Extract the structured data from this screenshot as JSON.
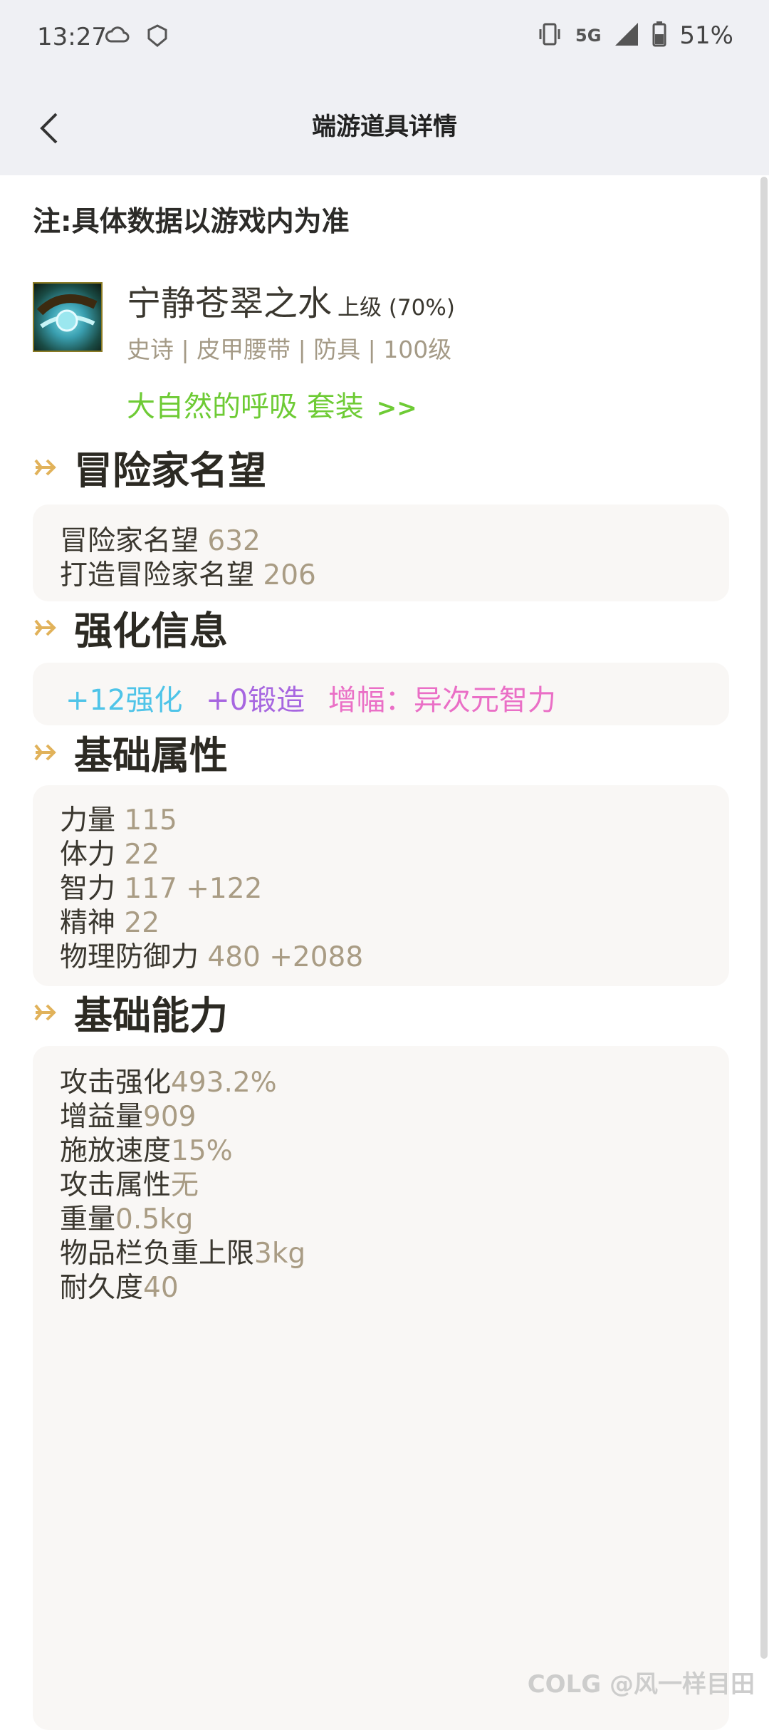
{
  "status_bar": {
    "time": "13:27",
    "network": "5G",
    "battery": "51%"
  },
  "header": {
    "title": "端游道具详情"
  },
  "note": "注:具体数据以游戏内为准",
  "item": {
    "name": "宁静苍翠之水",
    "grade": "上级 (70%)",
    "tags": "史诗  | 皮甲腰带  | 防具  | 100级",
    "set_name": "大自然的呼吸 套装",
    "set_arrows": ">>",
    "set_color": "#6ecb35"
  },
  "sections": {
    "reputation": {
      "title": "冒险家名望",
      "rows": [
        {
          "label": "冒险家名望",
          "value": " 632"
        },
        {
          "label": "打造冒险家名望",
          "value": " 206"
        }
      ]
    },
    "enhance": {
      "title": "强化信息",
      "reinforce": "+12强化",
      "reinforce_color": "#4fc4e8",
      "forge": "+0锻造",
      "forge_color": "#a766e0",
      "amplify": "增幅：异次元智力",
      "amplify_color": "#ea6fc6"
    },
    "base_attr": {
      "title": "基础属性",
      "rows": [
        {
          "label": "力量",
          "value": " 115"
        },
        {
          "label": "体力",
          "value": " 22"
        },
        {
          "label": "智力",
          "value": " 117 +122"
        },
        {
          "label": "精神",
          "value": " 22"
        },
        {
          "label": "物理防御力",
          "value": " 480 +2088"
        }
      ]
    },
    "base_ability": {
      "title": "基础能力",
      "rows": [
        {
          "label": "攻击强化",
          "value": "493.2%"
        },
        {
          "label": "增益量",
          "value": "909"
        },
        {
          "label": "施放速度",
          "value": "15%"
        },
        {
          "label": "攻击属性",
          "value": "无"
        },
        {
          "label": "重量",
          "value": "0.5kg"
        },
        {
          "label": "物品栏负重上限",
          "value": "3kg"
        },
        {
          "label": "耐久度",
          "value": "40"
        }
      ]
    }
  },
  "watermark": "COLG @风一样目田",
  "colors": {
    "section_arrow": "#e1b25a",
    "value_text": "#a99c84"
  }
}
